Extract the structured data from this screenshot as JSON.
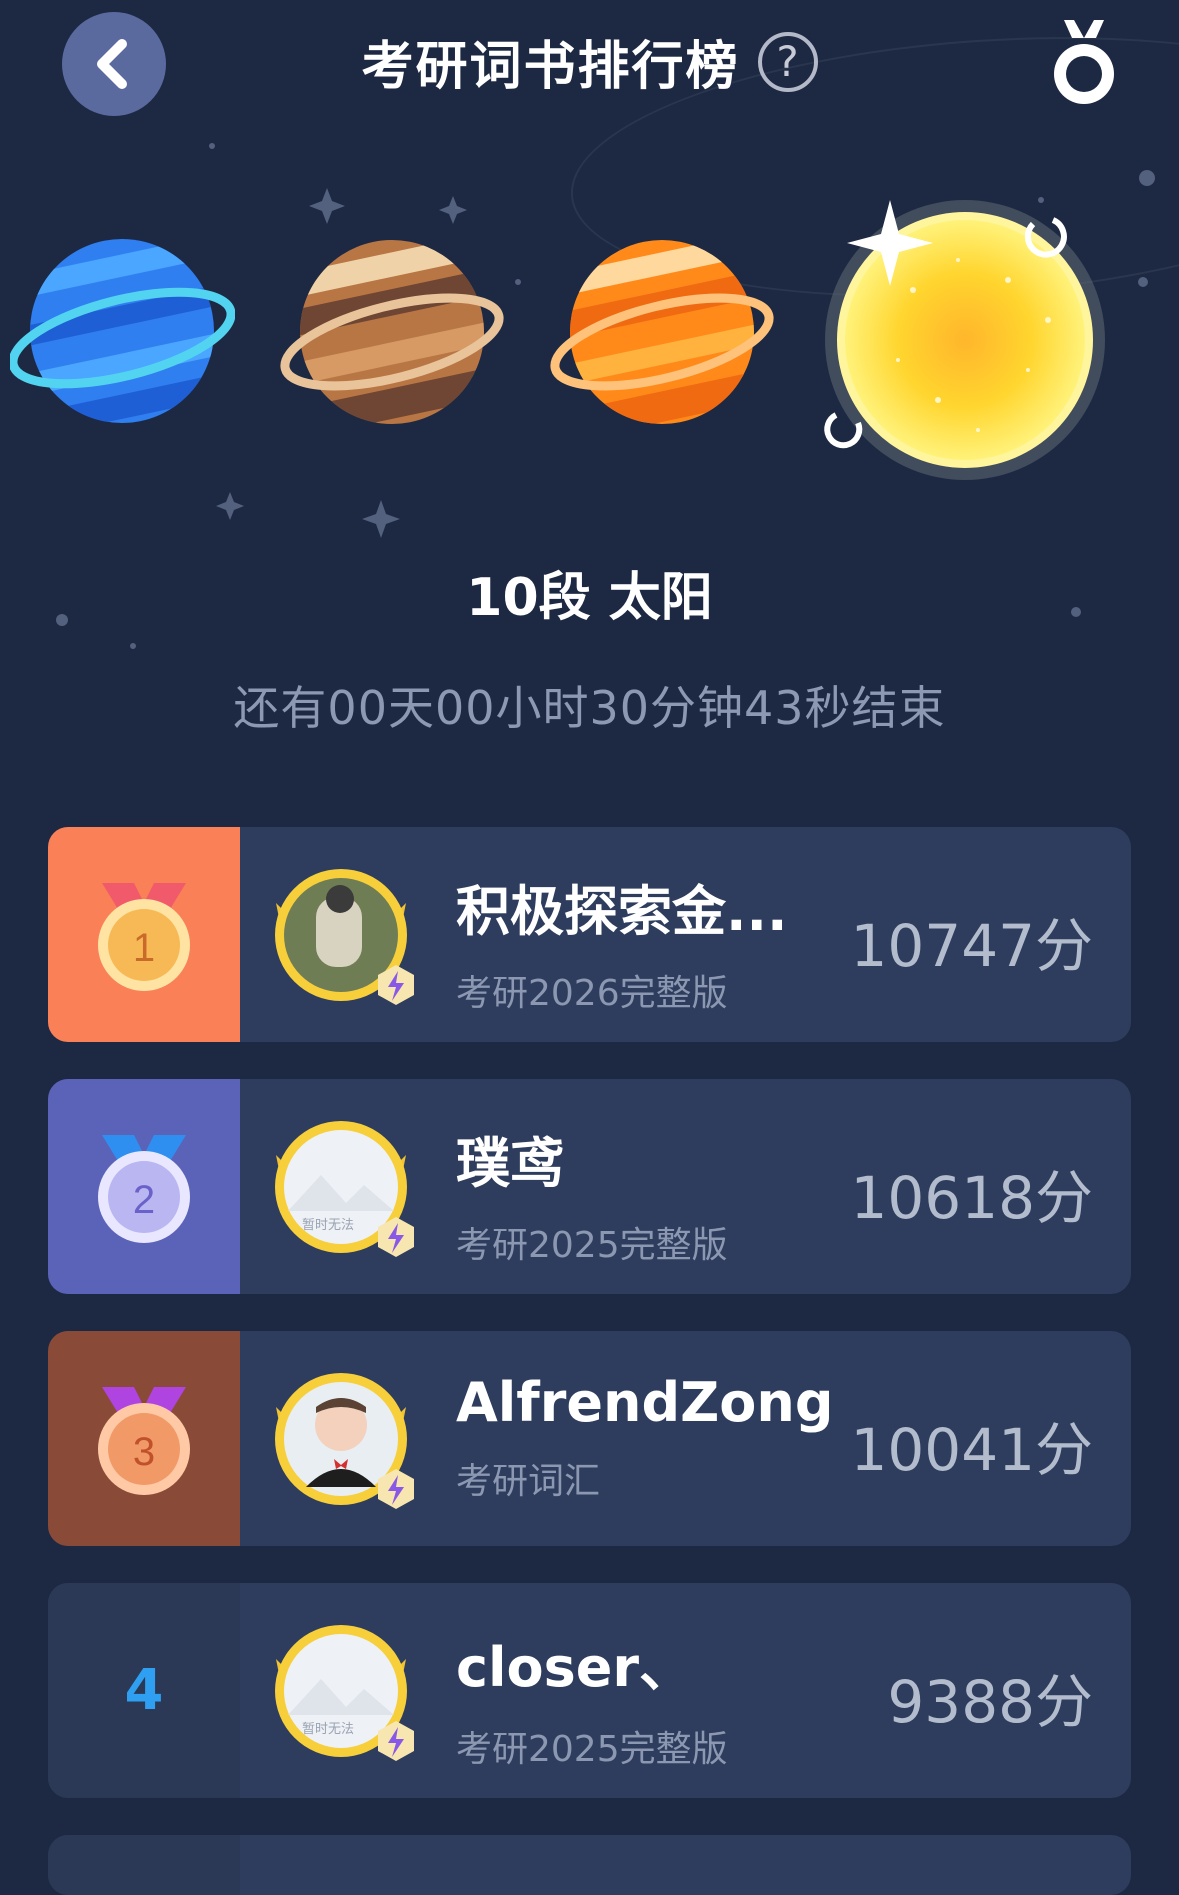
{
  "header": {
    "title": "考研词书排行榜",
    "help_glyph": "?"
  },
  "tier": {
    "name": "10段  太阳",
    "countdown": "还有00天00小时30分钟43秒结束"
  },
  "colors": {
    "background": "#1d2943",
    "row_bg": "#2e3d5d",
    "rank1_bg": "#fa8057",
    "rank2_bg": "#5b63b9",
    "rank3_bg": "#8a4a38",
    "rank_number": "#2f9ff1"
  },
  "rankings": [
    {
      "rank": "1",
      "name": "积极探索金...",
      "book": "考研2026完整版",
      "score": "10747分",
      "avatar_caption": ""
    },
    {
      "rank": "2",
      "name": "璞鸢",
      "book": "考研2025完整版",
      "score": "10618分",
      "avatar_caption": "暂时无法"
    },
    {
      "rank": "3",
      "name": "AlfrendZong",
      "book": "考研词汇",
      "score": "10041分",
      "avatar_caption": ""
    },
    {
      "rank": "4",
      "name": "closer、",
      "book": "考研2025完整版",
      "score": "9388分",
      "avatar_caption": "暂时无法"
    }
  ]
}
